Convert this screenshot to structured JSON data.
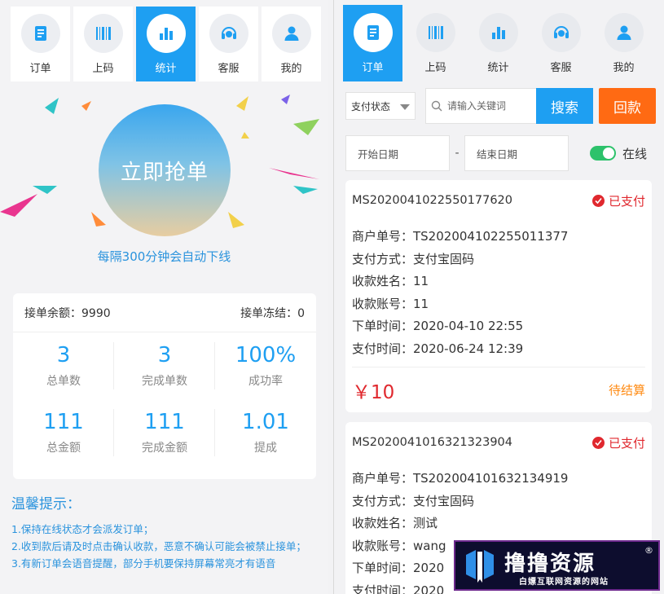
{
  "left_nav": [
    {
      "label": "订单",
      "icon": "clipboard-icon"
    },
    {
      "label": "上码",
      "icon": "barcode-icon"
    },
    {
      "label": "统计",
      "icon": "bar-chart-icon",
      "active": true
    },
    {
      "label": "客服",
      "icon": "headset-icon"
    },
    {
      "label": "我的",
      "icon": "user-icon"
    }
  ],
  "grab_button": "立即抢单",
  "auto_offline": "每隔300分钟会自动下线",
  "stats": {
    "balance": "接单余额：9990",
    "frozen": "接单冻结：0",
    "items": [
      {
        "value": "3",
        "label": "总单数"
      },
      {
        "value": "3",
        "label": "完成单数"
      },
      {
        "value": "100%",
        "label": "成功率"
      },
      {
        "value": "111",
        "label": "总金额"
      },
      {
        "value": "111",
        "label": "完成金额"
      },
      {
        "value": "1.01",
        "label": "提成"
      }
    ]
  },
  "tips": {
    "title": "温馨提示：",
    "lines": [
      "1.保持在线状态才会派发订单；",
      "2.收到款后请及时点击确认收款，恶意不确认可能会被禁止接单；",
      "3.有新订单会语音提醒，部分手机要保持屏幕常亮才有语音"
    ]
  },
  "right_nav": [
    {
      "label": "订单",
      "icon": "clipboard-icon",
      "active": true
    },
    {
      "label": "上码",
      "icon": "barcode-icon"
    },
    {
      "label": "统计",
      "icon": "bar-chart-icon"
    },
    {
      "label": "客服",
      "icon": "headset-icon"
    },
    {
      "label": "我的",
      "icon": "user-icon"
    }
  ],
  "filter": {
    "pay_status": "支付状态",
    "search_placeholder": "请输入关键词",
    "search_button": "搜索",
    "back_button": "回款",
    "start_date": "开始日期",
    "date_sep": "-",
    "end_date": "结束日期",
    "online_label": "在线"
  },
  "orders": [
    {
      "order_no": "MS2020041022550177620",
      "status": "已支付",
      "rows": [
        "商户单号：TS202004102255011377",
        "支付方式：支付宝固码",
        "收款姓名：11",
        "收款账号：11",
        "下单时间：2020-04-10 22:55",
        "支付时间：2020-06-24 12:39"
      ],
      "amount": "￥10",
      "settle": "待结算"
    },
    {
      "order_no": "MS2020041016321323904",
      "status": "已支付",
      "rows": [
        "商户单号：TS202004101632134919",
        "支付方式：支付宝固码",
        "收款姓名：测试",
        "收款账号：wang",
        "下单时间：2020",
        "支付时间：2020"
      ]
    }
  ],
  "watermark": {
    "brand": "撸撸资源",
    "sub": "白嫖互联网资源的网站",
    "reg": "®"
  },
  "colors": {
    "accent": "#1e9ff2",
    "orange": "#ff6a13",
    "red": "#e0282e",
    "green": "#2dc26b"
  }
}
